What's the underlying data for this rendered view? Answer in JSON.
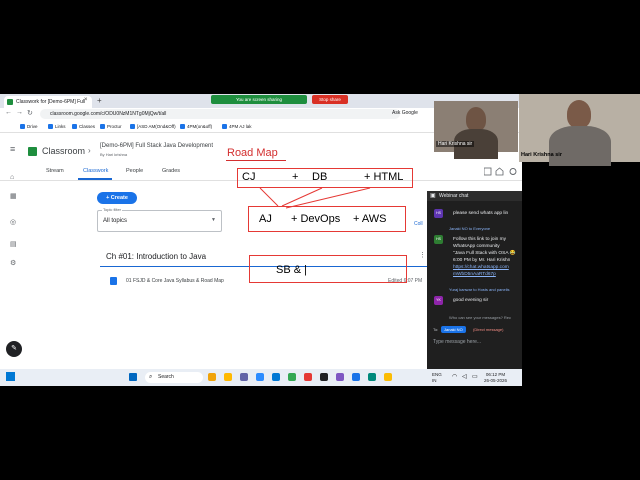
{
  "browser": {
    "tab_title": "Classwork for [Demo-6PM] Full",
    "close_tab": "×",
    "new_tab": "+",
    "sharing_text": "You are screen sharing",
    "stop_share": "Stop share",
    "url": "classroom.google.com/c/ODU0NzM1NTg0MjQw/t/all",
    "ask_google": "Ask Google",
    "bookmarks": [
      "Drive",
      "Links",
      "Classes",
      "Proctur",
      "[ASD AM(Ond&Off)",
      "4PM(on&off)",
      "4PM AJ lak"
    ]
  },
  "classroom": {
    "app_name": "Classroom",
    "course_title": "[Demo-6PM] Full Stack Java Development",
    "instructor": "By Hari krishna",
    "tabs": [
      "Stream",
      "Classwork",
      "People",
      "Grades"
    ],
    "create_label": "+ Create",
    "topic_filter_label": "Topic filter",
    "topic_filter_value": "All topics",
    "collapse_label": "Coll",
    "chapter_title": "Ch #01: Introduction to Java",
    "item_title": "01 FSJD & Core Java Syllabus & Road Map",
    "item_date": "Edited 6:07 PM"
  },
  "annotations": {
    "road_map": "Road Map",
    "cj": "CJ",
    "plus1": "+",
    "db": "DB",
    "html": "+ HTML",
    "aj": "AJ",
    "devops": "+ DevOps",
    "aws": "+ AWS",
    "sb": "SB & |",
    "red": "#e53935"
  },
  "video": {
    "small_name": "Hari Krishna sir",
    "large_name": "Hari Krishna sir"
  },
  "chat": {
    "header": "Webinar chat",
    "messages": [
      {
        "avatar": "HS",
        "text": "please send whats app lin",
        "from": ""
      },
      {
        "avatar": "",
        "text": "",
        "from": "Janaki NO to Everyone"
      },
      {
        "avatar": "HS",
        "text": "Follow this link to join my",
        "from": ""
      },
      {
        "avatar": "",
        "text": "WhatsApp community",
        "from": ""
      },
      {
        "avatar": "",
        "text": "\"Java Full Stack with OSA 😂",
        "from": ""
      },
      {
        "avatar": "",
        "text": "6:00 PM by Mr. Hari Krishn",
        "from": ""
      },
      {
        "avatar": "",
        "text": "https://chat.whatsapp.com",
        "from": ""
      },
      {
        "avatar": "",
        "text": "mWbD5nAaRTd67p",
        "from": ""
      },
      {
        "avatar": "",
        "text": "",
        "from": "Yuraj kanwar to Hosts and panelis"
      },
      {
        "avatar": "YK",
        "text": "good evening sir",
        "from": ""
      }
    ],
    "who_can_see": "Who can see your messages? Rec",
    "to_chip": "Janaki NO",
    "direct_message": "(Direct message)",
    "input_placeholder": "Type message here..."
  },
  "taskbar": {
    "search": "Search",
    "lang_line1": "ENG",
    "lang_line2": "IN",
    "time": "06:12 PM",
    "date": "26-05-2026"
  }
}
